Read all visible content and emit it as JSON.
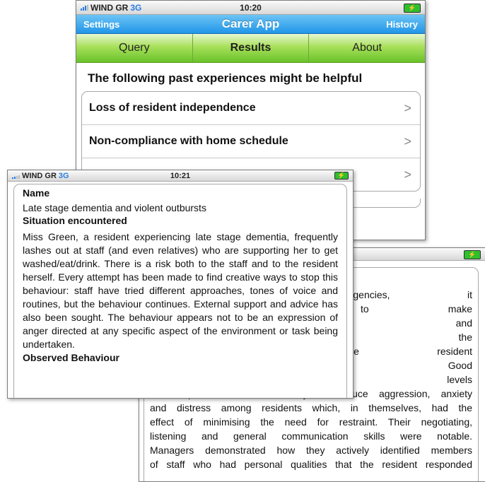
{
  "screen_back": {
    "status": {
      "carrier": "WIND GR",
      "network": "3G",
      "time": "10:20"
    },
    "nav": {
      "left": "Settings",
      "title": "Carer App",
      "right": "History"
    },
    "tabs": [
      {
        "label": "Query"
      },
      {
        "label": "Results"
      },
      {
        "label": "About"
      }
    ],
    "heading": "The following past experiences might be helpful",
    "results": [
      {
        "label": "Loss of resident independence"
      },
      {
        "label": "Non-compliance with home schedule"
      }
    ]
  },
  "screen_middle": {
    "lines": [
      "nd outside agencies, it",
      "ked capacity to make",
      "bing assessment and",
      "for supporting the",
      "arm while the resident",
      "s acceptable. Good",
      "monstrating high levels",
      "or competence in their ability to reduce aggression, anxiety",
      "and distress among residents which, in themselves, had the",
      "effect of minimising the need for restraint. Their negotiating,",
      "listening and general communication skills were notable.",
      "Managers demonstrated how they actively identified members",
      "of staff who had personal qualities that the resident responded"
    ]
  },
  "screen_front": {
    "status": {
      "carrier": "WIND GR",
      "network": "3G",
      "time": "10:21"
    },
    "name_label": "Name",
    "name_value": "Late stage dementia and violent outbursts",
    "situation_label": "Situation encountered",
    "situation_text": "Miss Green, a resident experiencing late stage dementia, frequently lashes out at staff (and even relatives) who are supporting her to get washed/eat/drink. There is a risk both to the staff and to the resident herself. Every attempt has been made to find creative ways to stop this behaviour: staff have tried different approaches, tones of voice and routines, but the behaviour continues. External support and advice has also been sought. The behaviour appears not to be an expression of anger directed at any specific aspect of the environment or task being undertaken.",
    "observed_label": "Observed Behaviour"
  }
}
